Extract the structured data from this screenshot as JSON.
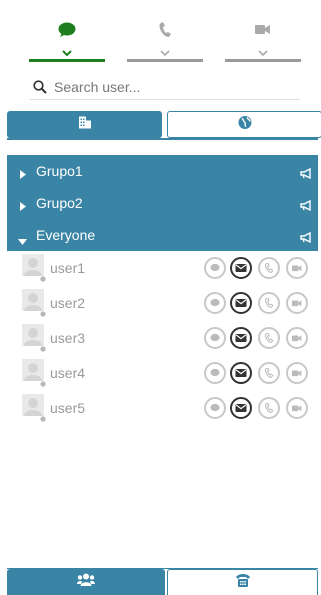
{
  "top_tabs": [
    {
      "icon": "chat-bubble-icon",
      "active": true
    },
    {
      "icon": "phone-icon",
      "active": false
    },
    {
      "icon": "video-camera-icon",
      "active": false
    }
  ],
  "search": {
    "placeholder": "Search user..."
  },
  "filter_tabs": [
    {
      "icon": "building-icon",
      "active": true
    },
    {
      "icon": "globe-icon",
      "active": false
    }
  ],
  "groups": [
    {
      "name": "Grupo1",
      "expanded": false
    },
    {
      "name": "Grupo2",
      "expanded": false
    },
    {
      "name": "Everyone",
      "expanded": true
    }
  ],
  "users": [
    {
      "name": "user1"
    },
    {
      "name": "user2"
    },
    {
      "name": "user3"
    },
    {
      "name": "user4"
    },
    {
      "name": "user5"
    }
  ],
  "user_actions": [
    "chat-icon",
    "email-icon",
    "call-icon",
    "video-icon"
  ],
  "bottom_tabs": [
    {
      "icon": "users-group-icon",
      "active": true
    },
    {
      "icon": "phonebook-icon",
      "active": false
    }
  ],
  "colors": {
    "accent": "#3a84a5",
    "active_green": "#1e7e1e",
    "muted": "#9a9a9a"
  }
}
